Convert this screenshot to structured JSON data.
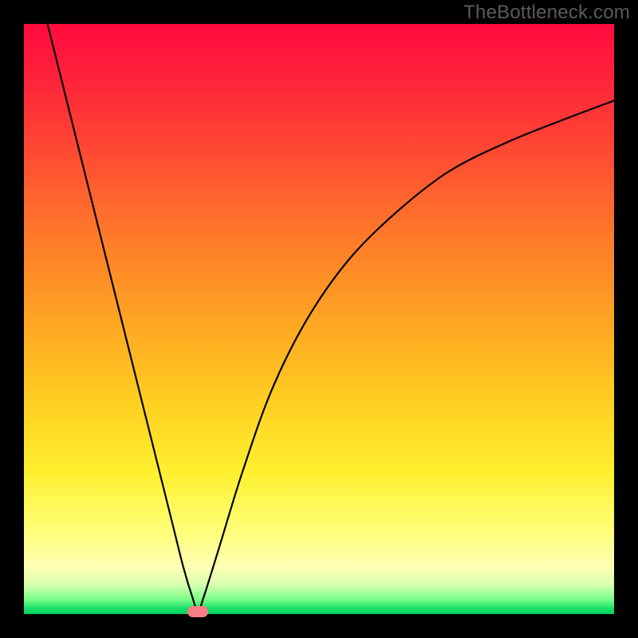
{
  "watermark": "TheBottleneck.com",
  "chart_data": {
    "type": "line",
    "title": "",
    "xlabel": "",
    "ylabel": "",
    "xlim": [
      0,
      100
    ],
    "ylim": [
      0,
      100
    ],
    "grid": false,
    "series": [
      {
        "name": "curve",
        "x": [
          4,
          7,
          10,
          13,
          16,
          19,
          22,
          25,
          27,
          28.5,
          29.5,
          30.5,
          33,
          37,
          42,
          48,
          55,
          63,
          72,
          82,
          92,
          100
        ],
        "values": [
          100,
          88,
          76,
          64,
          52,
          40,
          28,
          16,
          8,
          3,
          0.5,
          3,
          11,
          24,
          38,
          50,
          60,
          68,
          75,
          80,
          84,
          87
        ]
      }
    ],
    "min_point": {
      "x": 29.5,
      "y": 0.5
    },
    "marker": {
      "x": 29.5,
      "y": 0.0
    },
    "gradient_stops": [
      {
        "pct": 0,
        "color": "#ff0b3f"
      },
      {
        "pct": 50,
        "color": "#ffa423"
      },
      {
        "pct": 86,
        "color": "#ffff7a"
      },
      {
        "pct": 100,
        "color": "#00d060"
      }
    ]
  }
}
